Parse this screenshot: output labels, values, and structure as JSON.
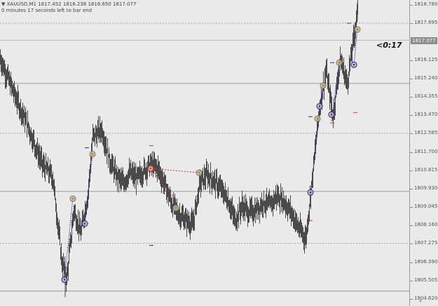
{
  "header": {
    "symbol_line": "▼ XAUUSD,M1  1817.452 1818.238 1816.650 1817.077",
    "timer_line": "0 minutes 17 seconds left to bar end"
  },
  "countdown": "<0:17",
  "price_axis": {
    "ticks": [
      "1818.780",
      "1817.895",
      "1817.077",
      "1816.125",
      "1815.240",
      "1814.355",
      "1813.470",
      "1812.585",
      "1811.700",
      "1810.815",
      "1809.930",
      "1809.045",
      "1808.160",
      "1807.275",
      "1806.390",
      "1805.505",
      "1804.620"
    ],
    "current_price": "1817.077",
    "corner_label": "+"
  },
  "colors": {
    "candles": "#4a4a4a",
    "level_line": "#9a9a9a",
    "dashed_line": "#a0a0a0",
    "link_blue": "#2a2aa8",
    "link_red": "#d03030",
    "marker_fill": "#c8b89a"
  },
  "chart_data": {
    "type": "line",
    "title": "XAUUSD,M1",
    "ylim": [
      1804.4,
      1818.9
    ],
    "series": [
      {
        "x": [
          0,
          20,
          40,
          60,
          75,
          88,
          95,
          105,
          115,
          125,
          132,
          145,
          155,
          165,
          175,
          185,
          195,
          205,
          215,
          225,
          235,
          245,
          255,
          265,
          275,
          285,
          295,
          305,
          315,
          325,
          335,
          345,
          355,
          365,
          375,
          385,
          395,
          405,
          415,
          425,
          436,
          445,
          455,
          465,
          475,
          485,
          495,
          505,
          510
        ],
        "values": [
          1816.2,
          1814.5,
          1812.9,
          1811.1,
          1810.5,
          1806.4,
          1805.6,
          1808.9,
          1807.8,
          1809.6,
          1812.4,
          1812.8,
          1811.4,
          1810.6,
          1810.2,
          1810.7,
          1810.4,
          1810.8,
          1811.1,
          1810.9,
          1810.1,
          1809.2,
          1808.7,
          1808.4,
          1808.2,
          1810.2,
          1810.6,
          1810.3,
          1809.9,
          1809.4,
          1808.4,
          1809.1,
          1808.8,
          1808.9,
          1809.3,
          1809.1,
          1809.6,
          1809.3,
          1808.8,
          1808.1,
          1807.5,
          1810.3,
          1813.7,
          1815.6,
          1813.4,
          1816.2,
          1815.0,
          1817.3,
          1818.6
        ]
      }
    ]
  }
}
